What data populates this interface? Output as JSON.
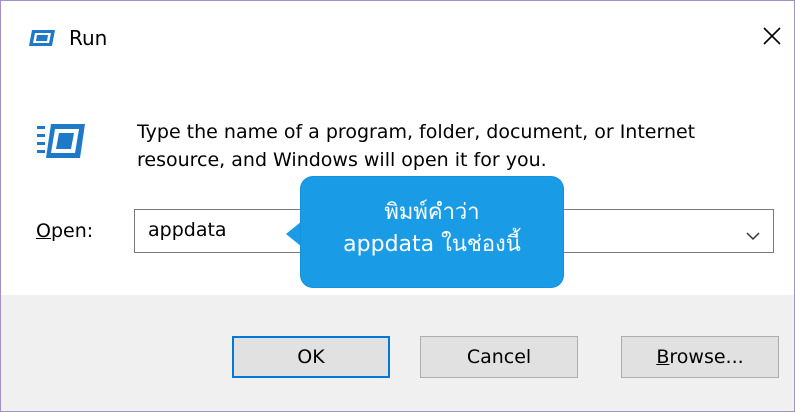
{
  "window": {
    "title": "Run",
    "icon": "run-app-icon",
    "close_icon": "close-icon"
  },
  "content": {
    "icon": "run-app-icon",
    "description_line1": "Type the name of a program, folder, document, or Internet",
    "description_line2": "resource, and Windows will open it for you.",
    "open_label_prefix": "O",
    "open_label_rest": "pen:",
    "open_value": "appdata",
    "dropdown_icon": "chevron-down-icon"
  },
  "buttons": {
    "ok": "OK",
    "cancel": "Cancel",
    "browse": "Browse..."
  },
  "callout": {
    "line1": "พิมพ์คำว่า",
    "line2": "appdata ในช่องนี้"
  },
  "colors": {
    "accent": "#0078d7",
    "callout": "#1a9be6",
    "footer": "#f0f0f0",
    "window_border": "#a58fc7"
  }
}
